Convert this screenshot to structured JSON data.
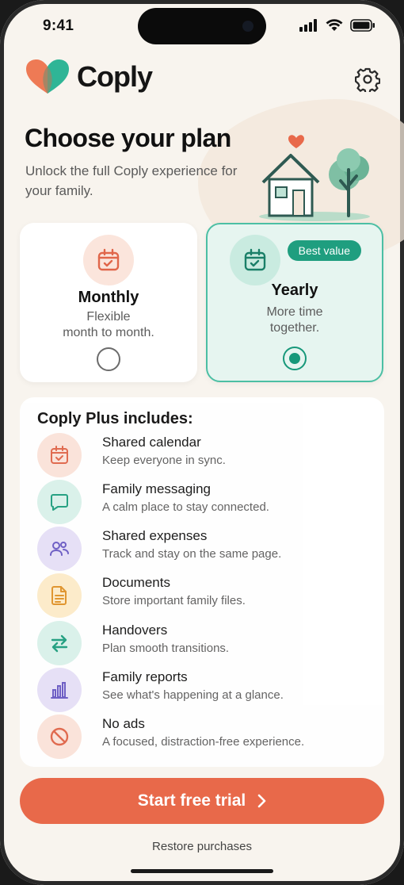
{
  "status_bar": {
    "time": "9:41"
  },
  "app": {
    "name": "Coply"
  },
  "header": {
    "title": "Choose your plan",
    "subtitle": "Unlock the full Coply experience for your family."
  },
  "plans": {
    "monthly": {
      "name": "Monthly",
      "desc_line1": "Flexible",
      "desc_line2": "month to month.",
      "selected": false,
      "icon": "calendar-icon"
    },
    "yearly": {
      "name": "Yearly",
      "desc_line1": "More time",
      "desc_line2": "together.",
      "badge": "Best value",
      "selected": true,
      "icon": "calendar-check-icon"
    }
  },
  "features": {
    "title": "Coply Plus includes:",
    "items": [
      {
        "title": "Shared calendar",
        "desc": "Keep everyone in sync.",
        "icon": "calendar-icon",
        "bg": "#fbe3da",
        "color": "#e0664a"
      },
      {
        "title": "Family messaging",
        "desc": "A calm place to stay connected.",
        "icon": "message-icon",
        "bg": "#d9f1ea",
        "color": "#1f9e7f"
      },
      {
        "title": "Shared expenses",
        "desc": "Track and stay on the same page.",
        "icon": "users-icon",
        "bg": "#e6e0f7",
        "color": "#6a5bc4"
      },
      {
        "title": "Documents",
        "desc": "Store important family files.",
        "icon": "document-icon",
        "bg": "#fdebc9",
        "color": "#e0932a"
      },
      {
        "title": "Handovers",
        "desc": "Plan smooth transitions.",
        "icon": "swap-arrows-icon",
        "bg": "#d9f1ea",
        "color": "#1f9e7f"
      },
      {
        "title": "Family reports",
        "desc": "See what's happening at a glance.",
        "icon": "bar-chart-icon",
        "bg": "#e6e0f7",
        "color": "#6a5bc4"
      },
      {
        "title": "No ads",
        "desc": "A focused, distraction-free experience.",
        "icon": "no-ads-icon",
        "bg": "#fbe3da",
        "color": "#e0664a"
      }
    ]
  },
  "cta": {
    "label": "Start free trial"
  },
  "footer": {
    "restore_label": "Restore purchases"
  },
  "colors": {
    "accent": "#e8694a",
    "teal": "#1f9e7f",
    "background": "#f8f4ee"
  }
}
